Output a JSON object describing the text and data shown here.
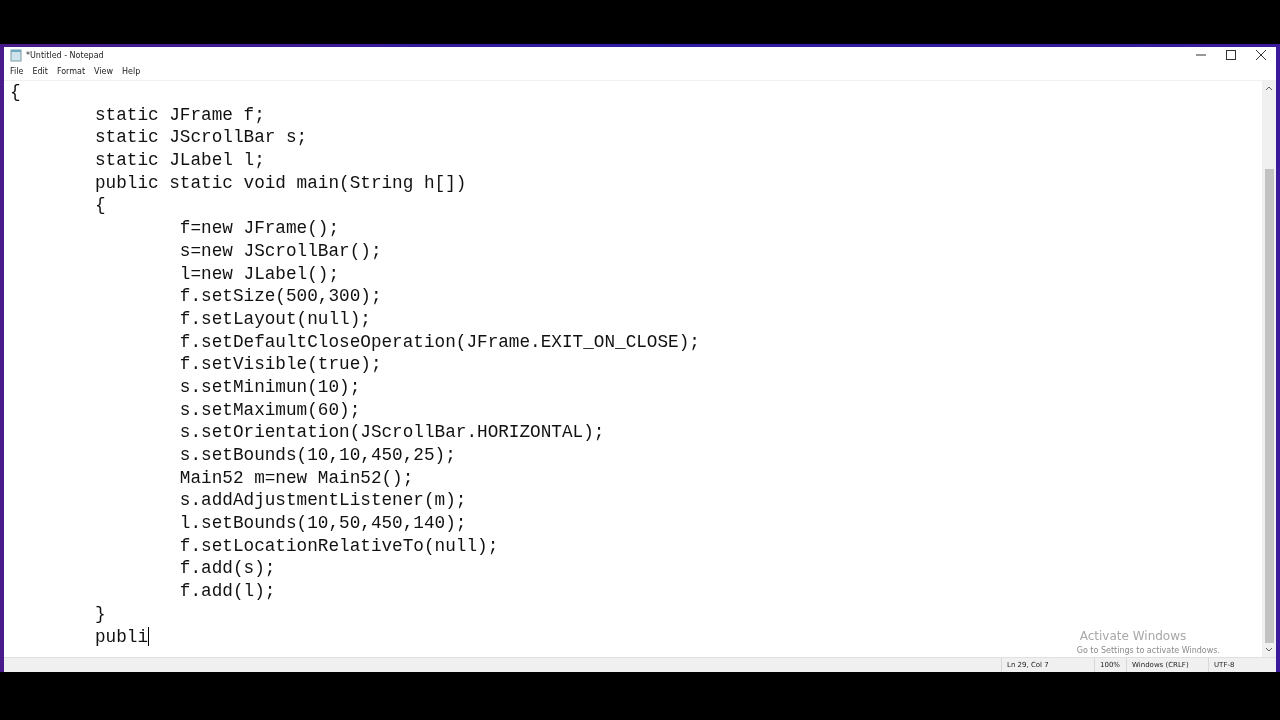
{
  "window": {
    "title": "*Untitled - Notepad"
  },
  "menu": [
    "File",
    "Edit",
    "Format",
    "View",
    "Help"
  ],
  "editor": {
    "lines": [
      "{",
      "\tstatic JFrame f;",
      "\tstatic JScrollBar s;",
      "\tstatic JLabel l;",
      "\tpublic static void main(String h[])",
      "\t{",
      "\t\tf=new JFrame();",
      "\t\ts=new JScrollBar();",
      "\t\tl=new JLabel();",
      "\t\tf.setSize(500,300);",
      "\t\tf.setLayout(null);",
      "\t\tf.setDefaultCloseOperation(JFrame.EXIT_ON_CLOSE);",
      "\t\tf.setVisible(true);",
      "\t\ts.setMinimun(10);",
      "\t\ts.setMaximum(60);",
      "\t\ts.setOrientation(JScrollBar.HORIZONTAL);",
      "\t\ts.setBounds(10,10,450,25);",
      "\t\tMain52 m=new Main52();",
      "\t\ts.addAdjustmentListener(m);",
      "\t\tl.setBounds(10,50,450,140);",
      "\t\tf.setLocationRelativeTo(null);",
      "\t\tf.add(s);",
      "\t\tf.add(l);",
      "\t}",
      "\tpubli"
    ]
  },
  "activation_notice": {
    "title": "Activate Windows",
    "subtitle": "Go to Settings to activate Windows."
  },
  "status_bar": [
    "Ln 29, Col 7",
    "100%",
    "Windows (CRLF)",
    "UTF-8"
  ]
}
